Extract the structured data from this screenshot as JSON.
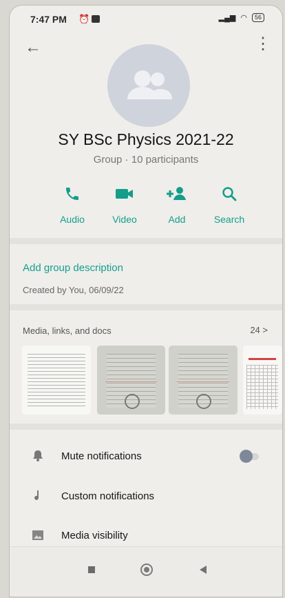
{
  "status_bar": {
    "time": "7:47 PM",
    "battery": "56"
  },
  "header": {
    "group_name": "SY BSc Physics 2021-22",
    "subtitle": "Group · 10 participants"
  },
  "actions": [
    {
      "label": "Audio",
      "icon": "phone-icon"
    },
    {
      "label": "Video",
      "icon": "video-icon"
    },
    {
      "label": "Add",
      "icon": "add-person-icon"
    },
    {
      "label": "Search",
      "icon": "search-icon"
    }
  ],
  "description": {
    "link_text": "Add group description",
    "created_text": "Created by You, 06/09/22"
  },
  "media": {
    "title": "Media, links, and docs",
    "count": "24 >"
  },
  "settings": [
    {
      "label": "Mute notifications",
      "icon": "bell-icon",
      "toggle": false
    },
    {
      "label": "Custom notifications",
      "icon": "music-note-icon"
    },
    {
      "label": "Media visibility",
      "icon": "image-icon"
    }
  ],
  "colors": {
    "accent": "#149d8b",
    "background": "#efeeea"
  }
}
